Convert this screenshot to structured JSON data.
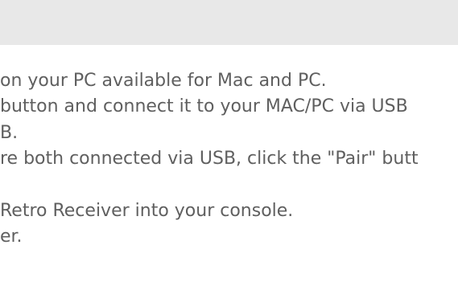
{
  "document": {
    "lines": [
      "on your PC available for Mac and PC.",
      " button and connect it to your MAC/PC via USB",
      "B.",
      "re both connected via USB, click the \"Pair\" butt",
      "",
      "Retro Receiver into your console.",
      "er."
    ]
  }
}
